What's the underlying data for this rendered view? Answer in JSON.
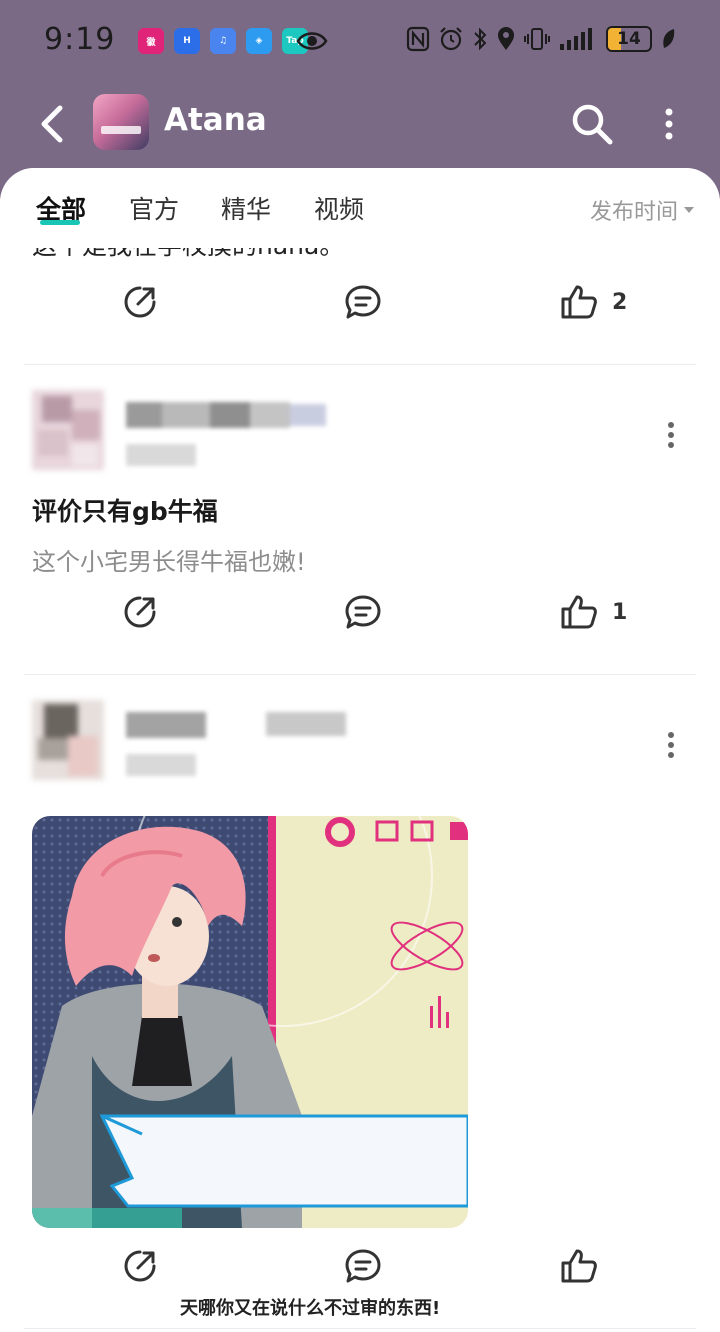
{
  "status_bar": {
    "time": "9:19",
    "battery": "14",
    "notification_icons": [
      "徽店会",
      "H",
      "music",
      "compass",
      "Tap"
    ],
    "accent_battery": "#f2b233"
  },
  "header": {
    "title": "Atana",
    "background": "#7b6a86"
  },
  "tabs": {
    "items": [
      "全部",
      "官方",
      "精华",
      "视频"
    ],
    "active": "全部",
    "sort_label": "发布时间",
    "accent": "#19c6b6"
  },
  "feed": {
    "partial_text": "这个是我在学校摸的nana。",
    "posts": [
      {
        "likes": "2"
      },
      {
        "title": "评价只有gb牛福",
        "body": "这个小宅男长得牛福也嫩!",
        "likes": "1"
      },
      {
        "image_caption": "天哪你又在说什么不过审的东西!",
        "likes": ""
      }
    ]
  }
}
